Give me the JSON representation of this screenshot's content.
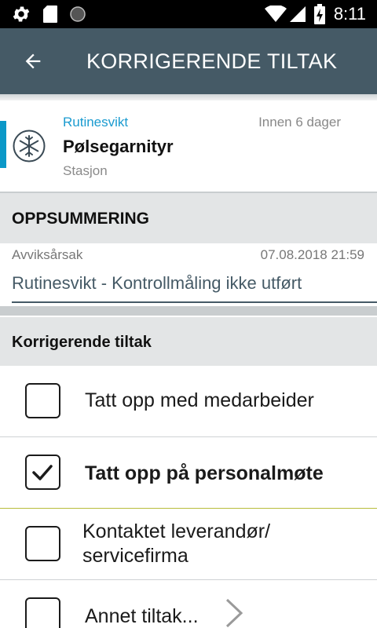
{
  "status_bar": {
    "time": "8:11",
    "icons": [
      "settings-icon",
      "sd-card-icon",
      "circle-icon",
      "wifi-icon",
      "signal-icon",
      "battery-charging-icon"
    ]
  },
  "app_bar": {
    "title": "KORRIGERENDE TILTAK",
    "back_icon": "arrow-back-icon",
    "color": "#455a66"
  },
  "task": {
    "category": "Rutinesvikt",
    "due": "Innen 6 dager",
    "name": "Pølsegarnityr",
    "location": "Stasjon",
    "icon": "snowflake-icon",
    "accent_color": "#0b98c8"
  },
  "summary": {
    "heading": "OPPSUMMERING",
    "reason_label": "Avviksårsak",
    "reason_date": "07.08.2018 21:59",
    "reason_value": "Rutinesvikt - Kontrollmåling ikke utført"
  },
  "actions": {
    "heading": "Korrigerende tiltak",
    "options": [
      {
        "label": "Tatt opp med medarbeider",
        "checked": false
      },
      {
        "label": "Tatt opp på personalmøte",
        "checked": true
      },
      {
        "label": "Kontaktet leverandør/ servicefirma",
        "checked": false
      },
      {
        "label": "Annet tiltak...",
        "checked": false,
        "icon": "chevron-right-icon"
      }
    ]
  }
}
